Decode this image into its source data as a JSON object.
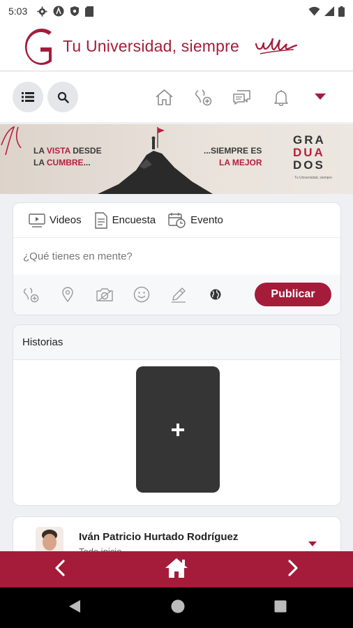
{
  "status_bar": {
    "time": "5:03"
  },
  "brand": {
    "title": "Tu Universidad, siempre",
    "signature": "udla"
  },
  "banner": {
    "left_line1_a": "LA ",
    "left_line1_red": "VISTA",
    "left_line1_b": " DESDE",
    "left_line2_a": "LA ",
    "left_line2_red": "CUMBRE",
    "left_line2_b": "...",
    "mid_line1": "...SIEMPRE ES",
    "mid_line2": "LA MEJOR",
    "grad1": "GRA",
    "grad2": "DUA",
    "grad3": "DOS",
    "grad_sub": "Tu Universidad, siempre"
  },
  "composer": {
    "tabs": [
      {
        "label": "Videos"
      },
      {
        "label": "Encuesta"
      },
      {
        "label": "Evento"
      }
    ],
    "placeholder": "¿Qué tienes en mente?",
    "publish_label": "Publicar"
  },
  "stories": {
    "title": "Historias"
  },
  "post": {
    "author": "Iván Patricio Hurtado Rodríguez",
    "subtitle": "Todo inicio"
  },
  "colors": {
    "accent": "#a41c3a",
    "icon_gray": "#8a8a8a"
  }
}
